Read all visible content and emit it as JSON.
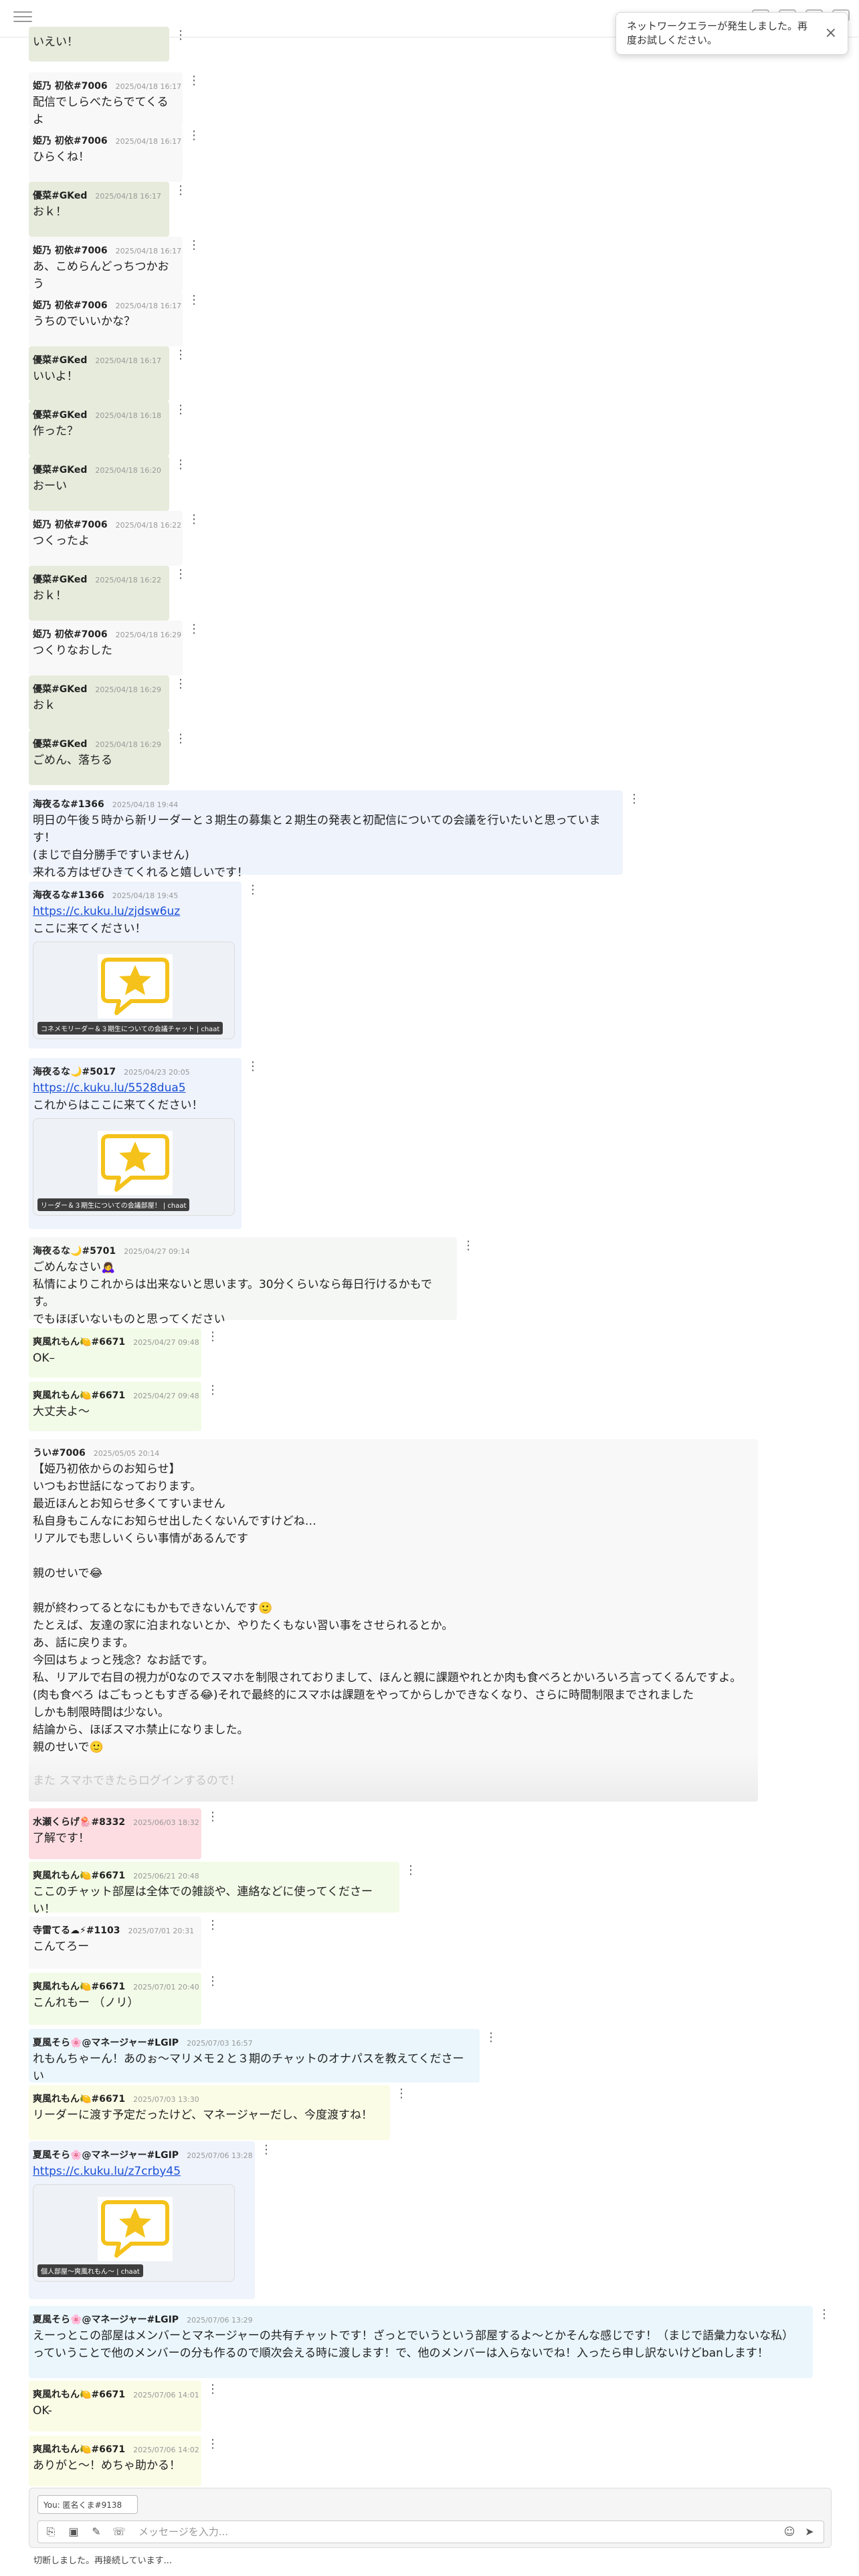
{
  "toast": {
    "text": "ネットワークエラーが発生しました。再度お試しください。",
    "close": "×"
  },
  "messages": [
    {
      "author": "",
      "time": "",
      "text": "いえい！"
    },
    {
      "author": "姫乃 初依#7006",
      "time": "2025/04/18 16:17",
      "text": "配信でしらべたらでてくるよ"
    },
    {
      "author": "姫乃 初依#7006",
      "time": "2025/04/18 16:17",
      "text": "ひらくね！"
    },
    {
      "author": "優菜#GKed",
      "time": "2025/04/18 16:17",
      "text": "おｋ！"
    },
    {
      "author": "姫乃 初依#7006",
      "time": "2025/04/18 16:17",
      "text": "あ、こめらんどっちつかおう"
    },
    {
      "author": "姫乃 初依#7006",
      "time": "2025/04/18 16:17",
      "text": "うちのでいいかな？"
    },
    {
      "author": "優菜#GKed",
      "time": "2025/04/18 16:17",
      "text": "いいよ！"
    },
    {
      "author": "優菜#GKed",
      "time": "2025/04/18 16:18",
      "text": "作った？"
    },
    {
      "author": "優菜#GKed",
      "time": "2025/04/18 16:20",
      "text": "おーい"
    },
    {
      "author": "姫乃 初依#7006",
      "time": "2025/04/18 16:22",
      "text": "つくったよ"
    },
    {
      "author": "優菜#GKed",
      "time": "2025/04/18 16:22",
      "text": "おｋ！"
    },
    {
      "author": "姫乃 初依#7006",
      "time": "2025/04/18 16:29",
      "text": "つくりなおした"
    },
    {
      "author": "優菜#GKed",
      "time": "2025/04/18 16:29",
      "text": "おｋ"
    },
    {
      "author": "優菜#GKed",
      "time": "2025/04/18 16:29",
      "text": "ごめん、落ちる"
    },
    {
      "author": "海夜るな#1366",
      "time": "2025/04/18 19:44",
      "text": "明日の午後５時から新リーダーと３期生の募集と２期生の発表と初配信についての会議を行いたいと思っています！\n(まじで自分勝手ですいません)\n来れる方はぜひきてくれると嬉しいです！"
    },
    {
      "author": "海夜るな#1366",
      "time": "2025/04/18 19:45",
      "link": "https://c.kuku.lu/zjdsw6uz",
      "text": "ここに来てください！",
      "preview": "コネメモリーダー＆３期生についての会議チャット | chaat"
    },
    {
      "author": "海夜るな🌙#5017",
      "time": "2025/04/23 20:05",
      "link": "https://c.kuku.lu/5528dua5",
      "text": "これからはここに来てください！",
      "preview": "リーダー＆３期生についての会議部屋！ | chaat"
    },
    {
      "author": "海夜るな🌙#5701",
      "time": "2025/04/27 09:14",
      "text": "ごめんなさい🙇‍♀\n私情によりこれからは出来ないと思います。30分くらいなら毎日行けるかもです。\nでもほぼいないものと思ってください"
    },
    {
      "author": "爽風れもん🍋#6671",
      "time": "2025/04/27 09:48",
      "text": "OK–"
    },
    {
      "author": "爽風れもん🍋#6671",
      "time": "2025/04/27 09:48",
      "text": "大丈夫よ～"
    },
    {
      "author": "うい#7006",
      "time": "2025/05/05 20:14",
      "text": "【姫乃初依からのお知らせ】\nいつもお世話になっております。\n最近ほんとお知らせ多くてすいません\n私自身もこんなにお知らせ出したくないんですけどね…\nリアルでも悲しいくらい事情があるんです\n\n親のせいで😂\n\n親が終わってるとなにもかもできないんです🙂\nたとえば、友達の家に泊まれないとか、やりたくもない習い事をさせられるとか。\nあ、話に戻ります。\n今回はちょっと残念？なお話です。\n私、リアルで右目の視力が0なのでスマホを制限されておりまして、ほんと親に課題やれとか肉も食べろとかいろいろ言ってくるんですよ。\n(肉も食べろ はごもっともすぎる😂)それで最終的にスマホは課題をやってからしかできなくなり、さらに時間制限までされました\nしかも制限時間は少ない。\n結論から、ほぼスマホ禁止になりました。\n親のせいで🙂",
      "fade": "また スマホできたらログインするので！"
    },
    {
      "author": "水瀬くらげ🪼#8332",
      "time": "2025/06/03 18:32",
      "text": "了解です！"
    },
    {
      "author": "爽風れもん🍋#6671",
      "time": "2025/06/21 20:48",
      "text": "ここのチャット部屋は全体での雑談や、連絡などに使ってくださーい！"
    },
    {
      "author": "寺雷てる☁⚡#1103",
      "time": "2025/07/01 20:31",
      "text": "こんてろー"
    },
    {
      "author": "爽風れもん🍋#6671",
      "time": "2025/07/01 20:40",
      "text": "こんれもー （ノリ）"
    },
    {
      "author": "夏風そら🌸@マネージャー#LGIP",
      "time": "2025/07/03 16:57",
      "text": "れもんちゃーん！あのぉ〜マリメモ２と３期のチャットのオナパスを教えてくださーい"
    },
    {
      "author": "爽風れもん🍋#6671",
      "time": "2025/07/03 13:30",
      "text": "リーダーに渡す予定だったけど、マネージャーだし、今度渡すね！"
    },
    {
      "author": "夏風そら🌸@マネージャー#LGIP",
      "time": "2025/07/06 13:28",
      "link": "https://c.kuku.lu/z7crby45",
      "text": "",
      "preview": "個人部屋〜爽風れもん〜 | chaat"
    },
    {
      "author": "夏風そら🌸@マネージャー#LGIP",
      "time": "2025/07/06 13:29",
      "text": "えーっとこの部屋はメンバーとマネージャーの共有チャットです！ざっとでいうという部屋するよ〜とかそんな感じです！（まじで語彙力ないな私）っていうことで他のメンバーの分も作るので順次会える時に渡します！で、他のメンバーは入らないでね！入ったら申し訳ないけどbanします！"
    },
    {
      "author": "爽風れもん🍋#6671",
      "time": "2025/07/06 14:01",
      "text": "OK-"
    },
    {
      "author": "爽風れもん🍋#6671",
      "time": "2025/07/06 14:02",
      "text": "ありがと～！めちゃ助かる！"
    }
  ],
  "composer": {
    "name_value": "You: 匿名くま#9138",
    "placeholder": "メッセージを入力...",
    "tools": [
      "attach-icon",
      "image-icon",
      "pen-icon",
      "call-icon"
    ],
    "emoji": "☺",
    "send": "➤"
  },
  "status": "切断しました。再接続しています..."
}
